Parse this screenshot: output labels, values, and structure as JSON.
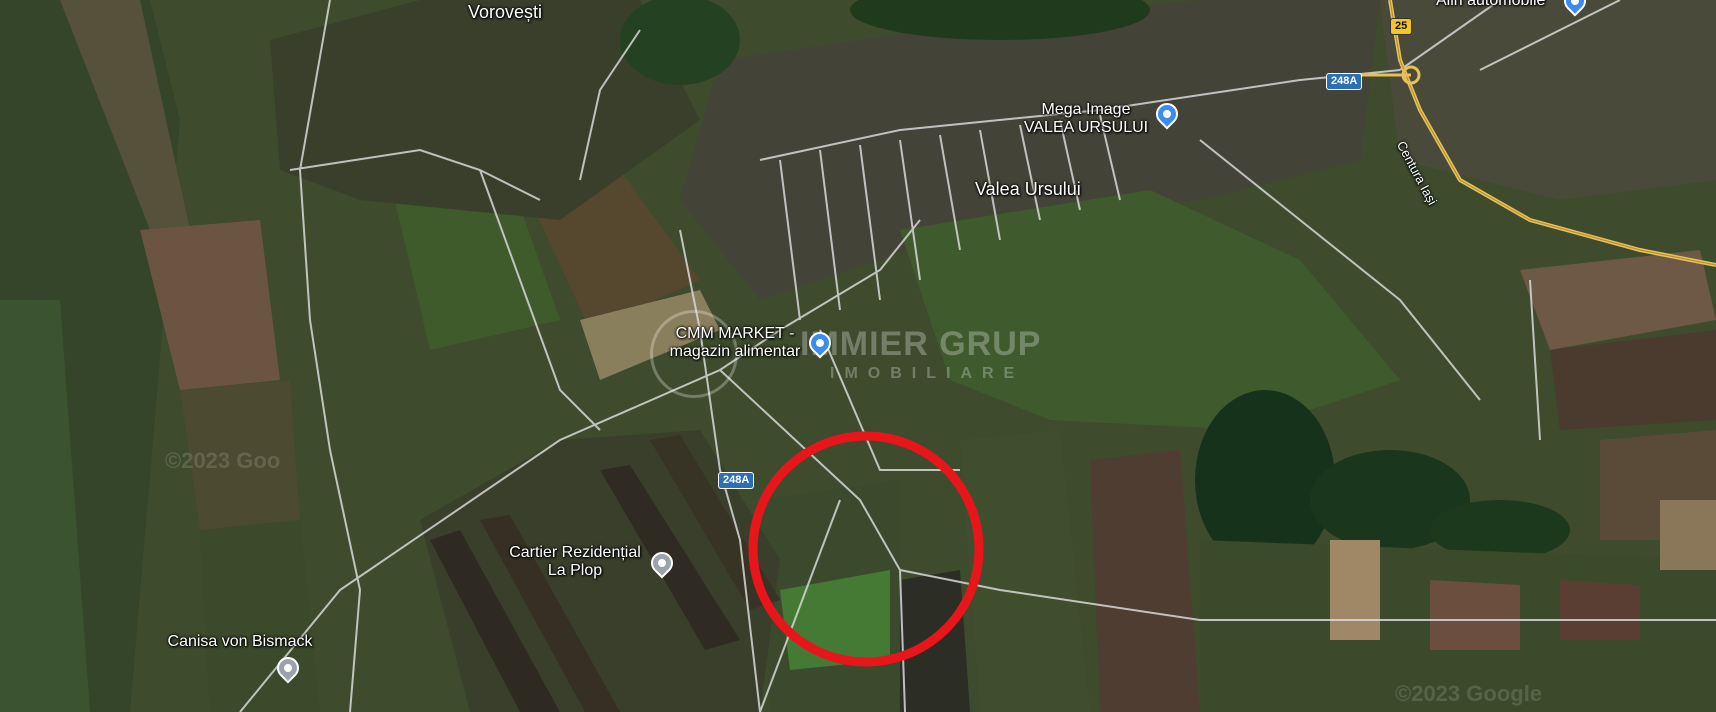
{
  "places": {
    "vorovesti": "Vorovești",
    "valea_ursului": "Valea Ursului",
    "mega_image_1": "Mega Image",
    "mega_image_2": "VALEA URSULUI",
    "cmm_market_1": "CMM MARKET -",
    "cmm_market_2": "magazin alimentar",
    "cartier_1": "Cartier Rezidențial",
    "cartier_2": "La Plop",
    "canisa": "Canisa von Bismack",
    "alin": "Alin automobile",
    "centura": "Centura Iași"
  },
  "roads": {
    "r248a_top": "248A",
    "r248a_mid": "248A",
    "r25": "25"
  },
  "watermark": {
    "main": "IMMIER GRUP",
    "sub": "IMOBILIARE"
  },
  "google": {
    "left": "©2023 Goo",
    "right": "©2023 Google"
  },
  "colors": {
    "highlight_circle": "#e8161b",
    "shop_pin": "#3b8cf2",
    "place_pin": "#9aa3ab",
    "route_yellow": "#e7c057",
    "road_white": "#d8d8d8"
  },
  "icons": {
    "shopping": "shopping-bag-icon",
    "place": "place-pin-icon"
  }
}
